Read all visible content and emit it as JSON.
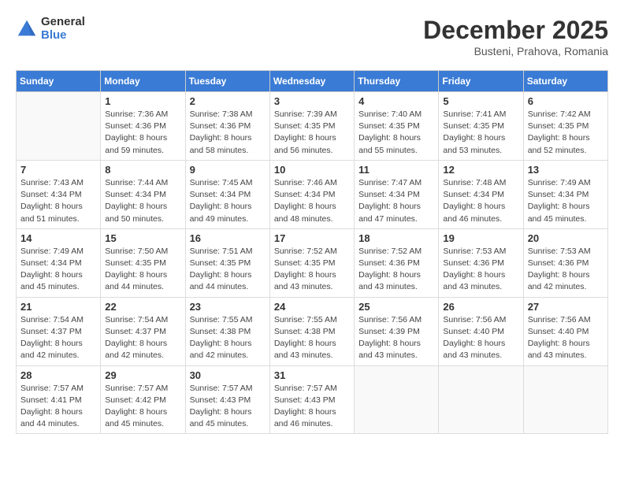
{
  "header": {
    "logo_general": "General",
    "logo_blue": "Blue",
    "month_title": "December 2025",
    "location": "Busteni, Prahova, Romania"
  },
  "days_of_week": [
    "Sunday",
    "Monday",
    "Tuesday",
    "Wednesday",
    "Thursday",
    "Friday",
    "Saturday"
  ],
  "weeks": [
    [
      {
        "day": "",
        "info": ""
      },
      {
        "day": "1",
        "info": "Sunrise: 7:36 AM\nSunset: 4:36 PM\nDaylight: 8 hours\nand 59 minutes."
      },
      {
        "day": "2",
        "info": "Sunrise: 7:38 AM\nSunset: 4:36 PM\nDaylight: 8 hours\nand 58 minutes."
      },
      {
        "day": "3",
        "info": "Sunrise: 7:39 AM\nSunset: 4:35 PM\nDaylight: 8 hours\nand 56 minutes."
      },
      {
        "day": "4",
        "info": "Sunrise: 7:40 AM\nSunset: 4:35 PM\nDaylight: 8 hours\nand 55 minutes."
      },
      {
        "day": "5",
        "info": "Sunrise: 7:41 AM\nSunset: 4:35 PM\nDaylight: 8 hours\nand 53 minutes."
      },
      {
        "day": "6",
        "info": "Sunrise: 7:42 AM\nSunset: 4:35 PM\nDaylight: 8 hours\nand 52 minutes."
      }
    ],
    [
      {
        "day": "7",
        "info": "Sunrise: 7:43 AM\nSunset: 4:34 PM\nDaylight: 8 hours\nand 51 minutes."
      },
      {
        "day": "8",
        "info": "Sunrise: 7:44 AM\nSunset: 4:34 PM\nDaylight: 8 hours\nand 50 minutes."
      },
      {
        "day": "9",
        "info": "Sunrise: 7:45 AM\nSunset: 4:34 PM\nDaylight: 8 hours\nand 49 minutes."
      },
      {
        "day": "10",
        "info": "Sunrise: 7:46 AM\nSunset: 4:34 PM\nDaylight: 8 hours\nand 48 minutes."
      },
      {
        "day": "11",
        "info": "Sunrise: 7:47 AM\nSunset: 4:34 PM\nDaylight: 8 hours\nand 47 minutes."
      },
      {
        "day": "12",
        "info": "Sunrise: 7:48 AM\nSunset: 4:34 PM\nDaylight: 8 hours\nand 46 minutes."
      },
      {
        "day": "13",
        "info": "Sunrise: 7:49 AM\nSunset: 4:34 PM\nDaylight: 8 hours\nand 45 minutes."
      }
    ],
    [
      {
        "day": "14",
        "info": "Sunrise: 7:49 AM\nSunset: 4:34 PM\nDaylight: 8 hours\nand 45 minutes."
      },
      {
        "day": "15",
        "info": "Sunrise: 7:50 AM\nSunset: 4:35 PM\nDaylight: 8 hours\nand 44 minutes."
      },
      {
        "day": "16",
        "info": "Sunrise: 7:51 AM\nSunset: 4:35 PM\nDaylight: 8 hours\nand 44 minutes."
      },
      {
        "day": "17",
        "info": "Sunrise: 7:52 AM\nSunset: 4:35 PM\nDaylight: 8 hours\nand 43 minutes."
      },
      {
        "day": "18",
        "info": "Sunrise: 7:52 AM\nSunset: 4:36 PM\nDaylight: 8 hours\nand 43 minutes."
      },
      {
        "day": "19",
        "info": "Sunrise: 7:53 AM\nSunset: 4:36 PM\nDaylight: 8 hours\nand 43 minutes."
      },
      {
        "day": "20",
        "info": "Sunrise: 7:53 AM\nSunset: 4:36 PM\nDaylight: 8 hours\nand 42 minutes."
      }
    ],
    [
      {
        "day": "21",
        "info": "Sunrise: 7:54 AM\nSunset: 4:37 PM\nDaylight: 8 hours\nand 42 minutes."
      },
      {
        "day": "22",
        "info": "Sunrise: 7:54 AM\nSunset: 4:37 PM\nDaylight: 8 hours\nand 42 minutes."
      },
      {
        "day": "23",
        "info": "Sunrise: 7:55 AM\nSunset: 4:38 PM\nDaylight: 8 hours\nand 42 minutes."
      },
      {
        "day": "24",
        "info": "Sunrise: 7:55 AM\nSunset: 4:38 PM\nDaylight: 8 hours\nand 43 minutes."
      },
      {
        "day": "25",
        "info": "Sunrise: 7:56 AM\nSunset: 4:39 PM\nDaylight: 8 hours\nand 43 minutes."
      },
      {
        "day": "26",
        "info": "Sunrise: 7:56 AM\nSunset: 4:40 PM\nDaylight: 8 hours\nand 43 minutes."
      },
      {
        "day": "27",
        "info": "Sunrise: 7:56 AM\nSunset: 4:40 PM\nDaylight: 8 hours\nand 43 minutes."
      }
    ],
    [
      {
        "day": "28",
        "info": "Sunrise: 7:57 AM\nSunset: 4:41 PM\nDaylight: 8 hours\nand 44 minutes."
      },
      {
        "day": "29",
        "info": "Sunrise: 7:57 AM\nSunset: 4:42 PM\nDaylight: 8 hours\nand 45 minutes."
      },
      {
        "day": "30",
        "info": "Sunrise: 7:57 AM\nSunset: 4:43 PM\nDaylight: 8 hours\nand 45 minutes."
      },
      {
        "day": "31",
        "info": "Sunrise: 7:57 AM\nSunset: 4:43 PM\nDaylight: 8 hours\nand 46 minutes."
      },
      {
        "day": "",
        "info": ""
      },
      {
        "day": "",
        "info": ""
      },
      {
        "day": "",
        "info": ""
      }
    ]
  ]
}
